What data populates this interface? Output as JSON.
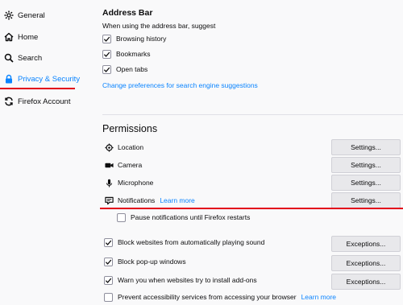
{
  "sidebar": {
    "items": [
      {
        "label": "General",
        "icon": "gear-icon"
      },
      {
        "label": "Home",
        "icon": "home-icon"
      },
      {
        "label": "Search",
        "icon": "search-icon"
      },
      {
        "label": "Privacy & Security",
        "icon": "lock-icon",
        "active": true
      },
      {
        "label": "Firefox Account",
        "icon": "sync-icon"
      }
    ]
  },
  "address_bar": {
    "heading": "Address Bar",
    "description": "When using the address bar, suggest",
    "options": [
      {
        "label": "Browsing history",
        "checked": true
      },
      {
        "label": "Bookmarks",
        "checked": true
      },
      {
        "label": "Open tabs",
        "checked": true
      }
    ],
    "link": "Change preferences for search engine suggestions"
  },
  "permissions": {
    "heading": "Permissions",
    "items": [
      {
        "label": "Location",
        "icon": "location-icon",
        "button": "Settings..."
      },
      {
        "label": "Camera",
        "icon": "camera-icon",
        "button": "Settings..."
      },
      {
        "label": "Microphone",
        "icon": "microphone-icon",
        "button": "Settings..."
      },
      {
        "label": "Notifications",
        "icon": "notification-icon",
        "button": "Settings...",
        "learn_more": "Learn more"
      }
    ],
    "pause_notifications": {
      "label": "Pause notifications until Firefox restarts",
      "checked": false
    },
    "block_options": [
      {
        "label": "Block websites from automatically playing sound",
        "checked": true,
        "button": "Exceptions..."
      },
      {
        "label": "Block pop-up windows",
        "checked": true,
        "button": "Exceptions..."
      },
      {
        "label": "Warn you when websites try to install add-ons",
        "checked": true,
        "button": "Exceptions..."
      },
      {
        "label": "Prevent accessibility services from accessing your browser",
        "checked": false,
        "learn_more": "Learn more"
      }
    ]
  },
  "colors": {
    "accent": "#0a84ff",
    "highlight": "#e2001a"
  }
}
